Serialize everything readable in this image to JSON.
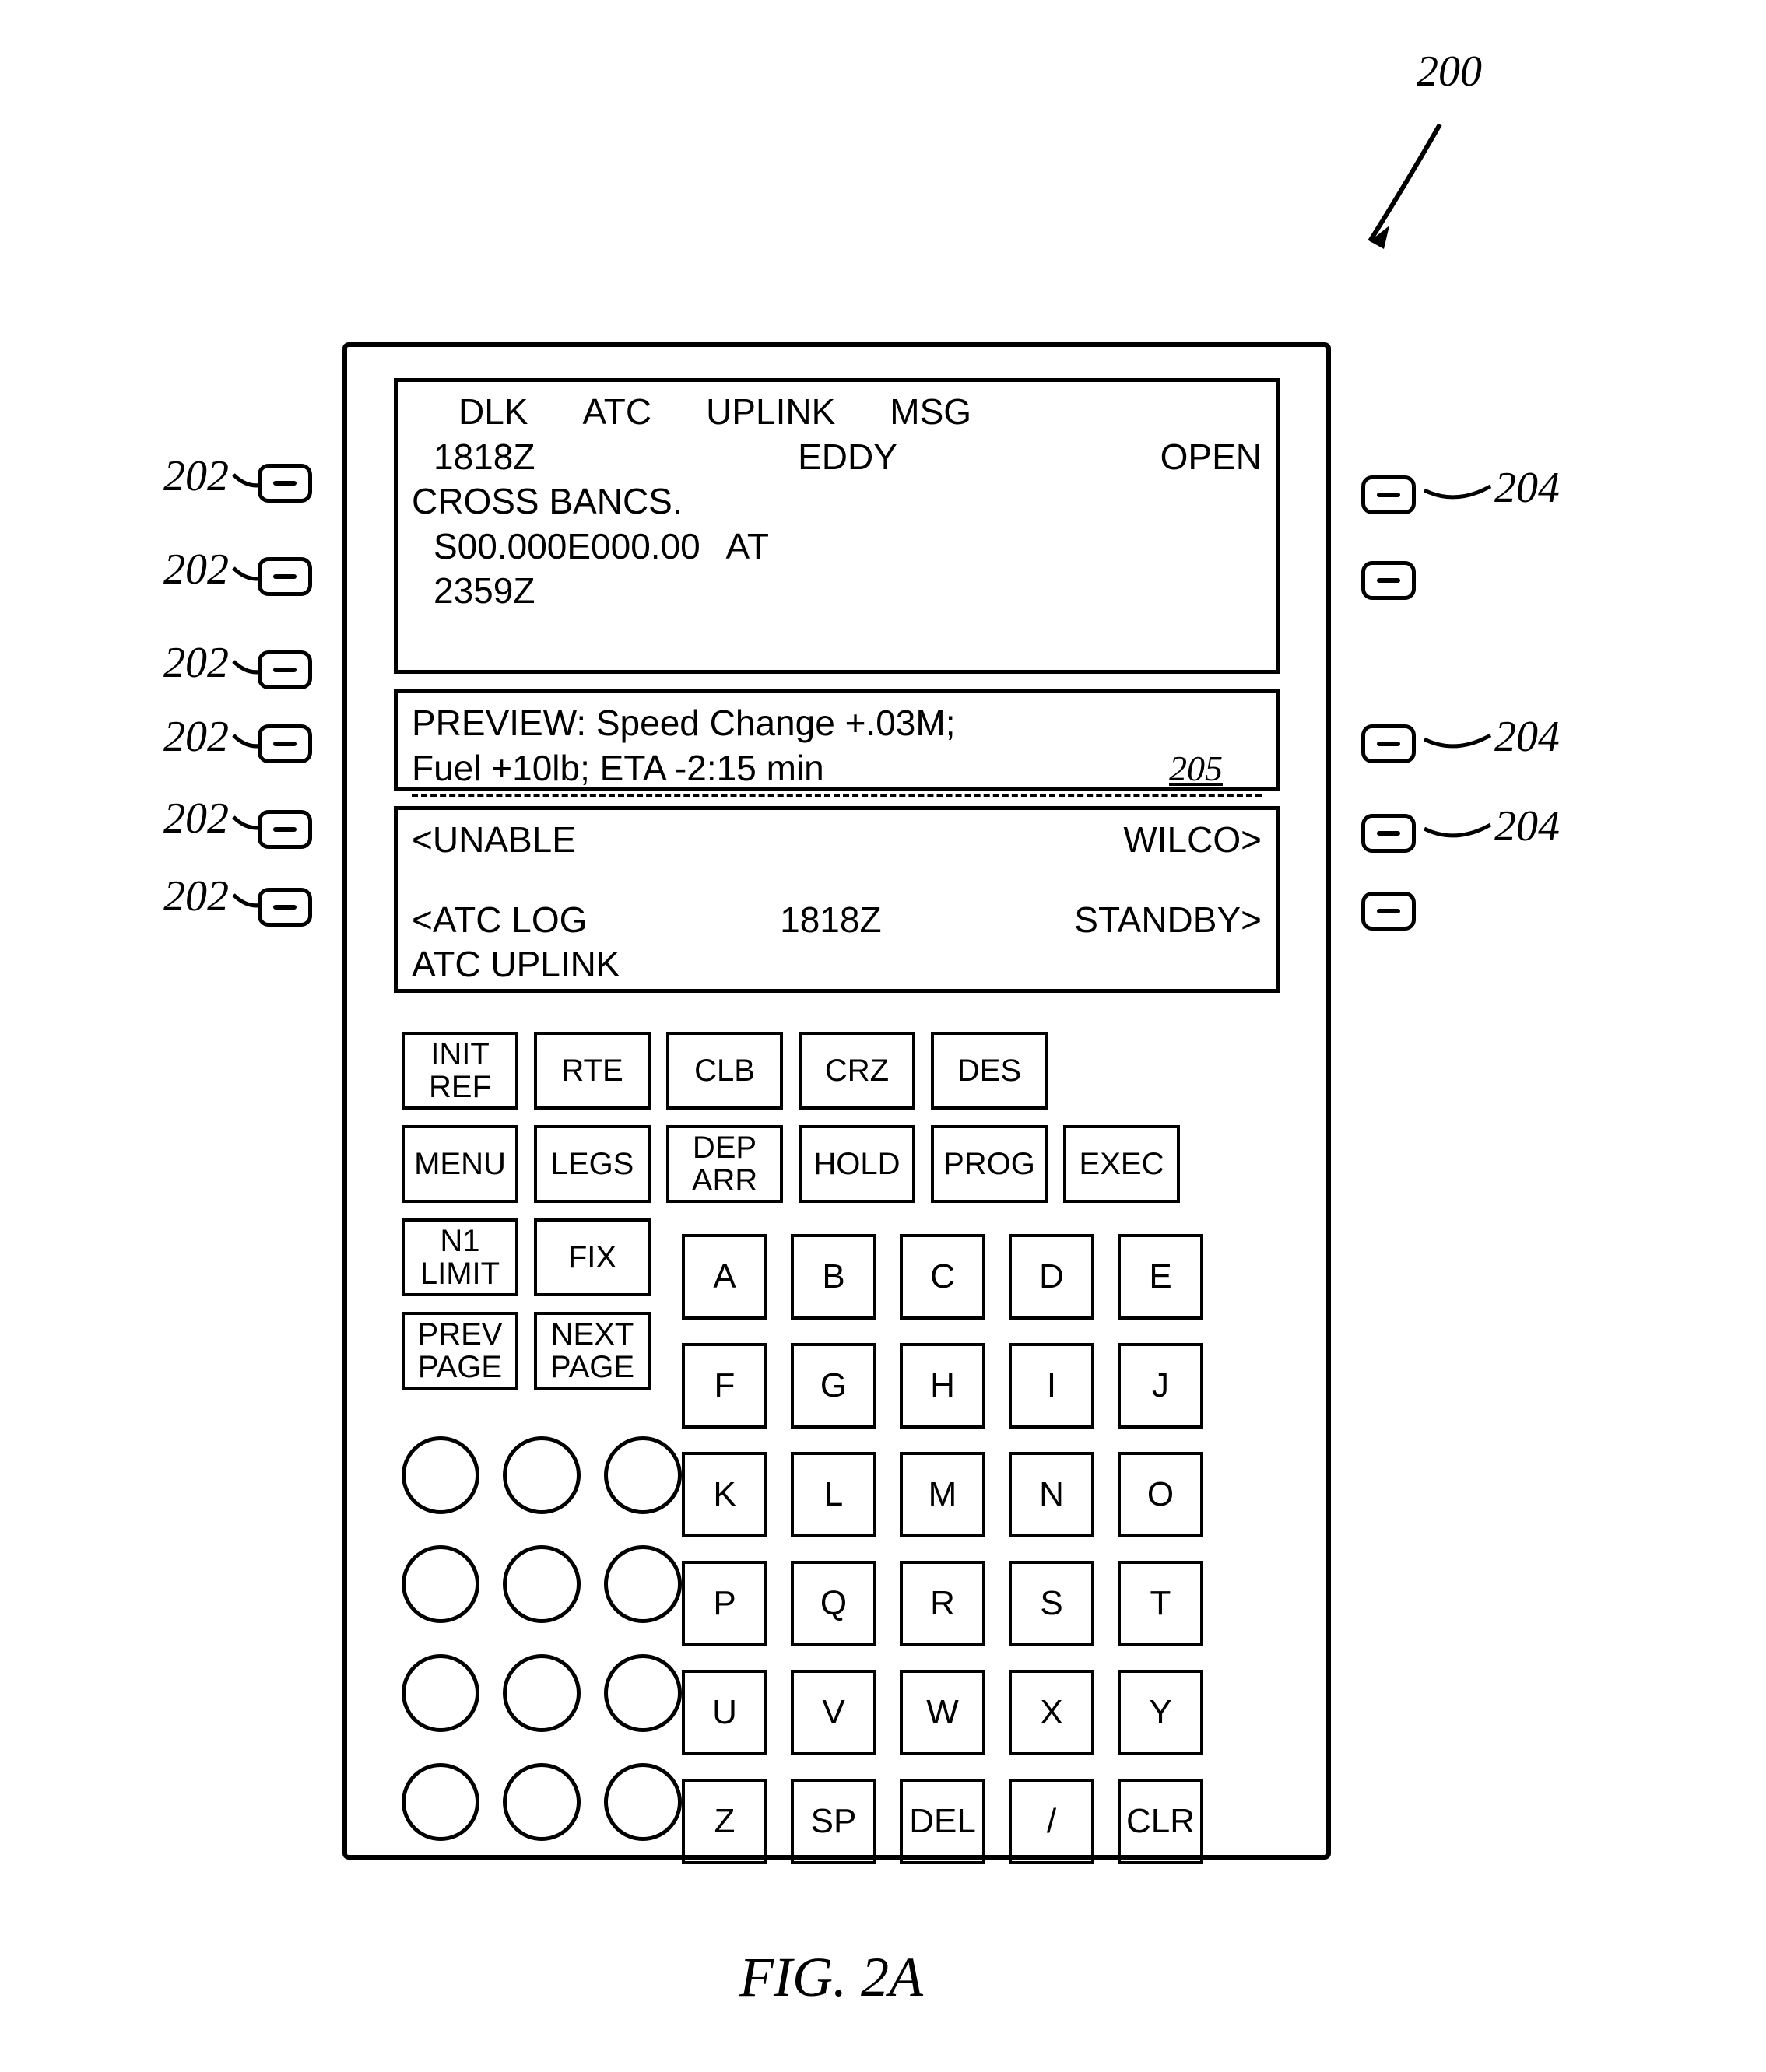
{
  "figure": {
    "ref_main": "200",
    "caption": "FIG. 2A"
  },
  "callouts": {
    "left_lsk": "202",
    "right_lsk": "204",
    "exec_key": "202",
    "alpha_key": "202",
    "preview_ref": "205"
  },
  "display": {
    "header": {
      "c1": "DLK",
      "c2": "ATC",
      "c3": "UPLINK",
      "c4": "MSG"
    },
    "line2_left": "1818Z",
    "line2_center": "EDDY",
    "line2_right": "OPEN",
    "line3": "CROSS BANCS.",
    "line4_left": "S00.000E000.00",
    "line4_right": "AT",
    "line5": "2359Z",
    "preview_l1": "PREVIEW: Speed Change +.03M;",
    "preview_l2": "Fuel +10lb; ETA -2:15 min",
    "resp_left1": "<UNABLE",
    "resp_right1": "WILCO>",
    "resp_left2": "<ATC LOG",
    "resp_center2": "1818Z",
    "resp_right2": "STANDBY>",
    "footer": "ATC UPLINK"
  },
  "fn_keys_row1": [
    "INIT\nREF",
    "RTE",
    "CLB",
    "CRZ",
    "DES",
    ""
  ],
  "fn_keys_row2": [
    "MENU",
    "LEGS",
    "DEP\nARR",
    "HOLD",
    "PROG",
    "EXEC"
  ],
  "fn_keys_row3": [
    "N1\nLIMIT",
    "FIX"
  ],
  "fn_keys_row4": [
    "PREV\nPAGE",
    "NEXT\nPAGE"
  ],
  "alpha_keys": [
    "A",
    "B",
    "C",
    "D",
    "E",
    "F",
    "G",
    "H",
    "I",
    "J",
    "K",
    "L",
    "M",
    "N",
    "O",
    "P",
    "Q",
    "R",
    "S",
    "T",
    "U",
    "V",
    "W",
    "X",
    "Y",
    "Z",
    "SP",
    "DEL",
    "/",
    "CLR"
  ]
}
